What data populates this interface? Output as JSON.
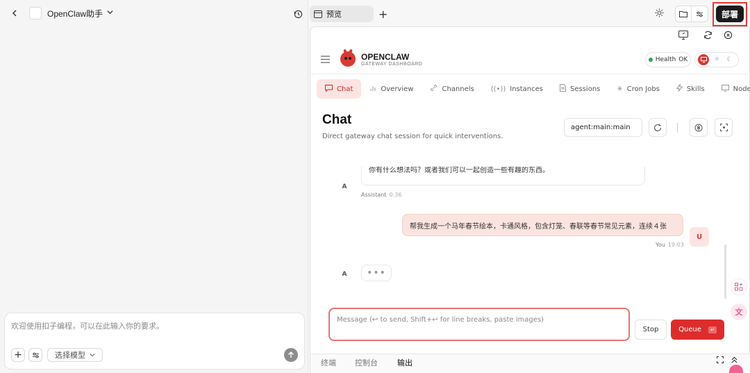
{
  "left_panel": {
    "back_icon": "chevron-left-icon",
    "app_title": "OpenClaw助手",
    "history_icon": "history-icon",
    "prompt": {
      "placeholder": "欢迎使用扣子编程，可以在此输入你的要求。",
      "model_label": "选择模型"
    }
  },
  "top_bar": {
    "preview_tab": "预览",
    "deploy_label": "部署",
    "accent_color": "#1a1a1a",
    "highlight_color": "#e53935"
  },
  "gateway": {
    "brand": "OPENCLAW",
    "brand_sub": "GATEWAY DASHBOARD",
    "health_label": "Health",
    "health_value": "OK",
    "brand_color": "#d83a34",
    "nav": [
      {
        "label": "Chat",
        "icon": "chat-icon",
        "active": true
      },
      {
        "label": "Overview",
        "icon": "bar-chart-icon"
      },
      {
        "label": "Channels",
        "icon": "link-icon"
      },
      {
        "label": "Instances",
        "icon": "radio-icon"
      },
      {
        "label": "Sessions",
        "icon": "document-icon"
      },
      {
        "label": "Cron Jobs",
        "icon": "loader-icon"
      },
      {
        "label": "Skills",
        "icon": "zap-icon"
      },
      {
        "label": "Node",
        "icon": "monitor-icon"
      }
    ],
    "chat": {
      "title": "Chat",
      "subtitle": "Direct gateway chat session for quick interventions.",
      "agent": "agent:main:main"
    },
    "messages": [
      {
        "role": "assistant",
        "avatar": "A",
        "text": "你有什么想法吗？或者我们可以一起创造一些有趣的东西。",
        "sender": "Assistant",
        "time": "0:36"
      },
      {
        "role": "user",
        "avatar": "U",
        "text": "帮我生成一个马年春节绘本，卡通风格，包含灯笼、春联等春节常见元素，连续４张",
        "sender": "You",
        "time": "19:03"
      },
      {
        "role": "assistant",
        "avatar": "A",
        "typing": "•••"
      }
    ],
    "composer": {
      "placeholder": "Message (↩ to send, Shift+↩ for line breaks, paste images)",
      "stop_label": "Stop",
      "queue_label": "Queue",
      "queue_key": "↵"
    }
  },
  "bottom_tabs": [
    {
      "label": "终端"
    },
    {
      "label": "控制台"
    },
    {
      "label": "输出",
      "active": true
    }
  ]
}
